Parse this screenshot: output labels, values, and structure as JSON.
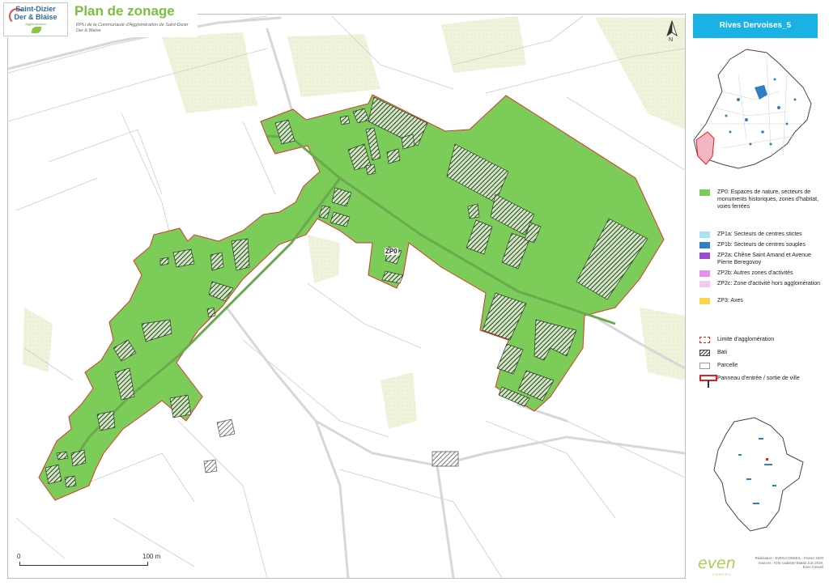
{
  "header": {
    "logo_line1": "Saint-Dizier",
    "logo_line2": "Der & Blaise",
    "logo_line3": "Agglomération",
    "title": "Plan de zonage",
    "subtitle": "RPLi de la Communauté d'Agglomération de Saint-Dizier Der & Blaise"
  },
  "panel": {
    "header": "Rives Dervoises_5"
  },
  "map": {
    "zone_label": "ZP0",
    "north_label": "N",
    "scale_start": "0",
    "scale_end": "100 m",
    "zone_fill_color": "#7ccc5a",
    "zone_outline_color": "#e0342a"
  },
  "legend": [
    {
      "label": "ZP0: Espaces de nature, secteurs de monuments historiques, zones d'habitat, voies ferrées",
      "color": "#7ccc5a",
      "kind": "fill"
    },
    {
      "label": "ZP1a: Secteurs de centres stictes",
      "color": "#a9e3f2",
      "kind": "fill"
    },
    {
      "label": "ZP1b: Secteurs de centres souples",
      "color": "#2f7fc4",
      "kind": "fill"
    },
    {
      "label": "ZP2a: Chêne Saint Amand et Avenue Pierre Beregovoy",
      "color": "#9a4fc9",
      "kind": "fill"
    },
    {
      "label": "ZP2b: Autres zones d'activités",
      "color": "#e98ff0",
      "kind": "fill"
    },
    {
      "label": "ZP2c: Zone d'activité hors agglomération",
      "color": "#f6c7ef",
      "kind": "fill"
    },
    {
      "label": "ZP3: Axes",
      "color": "#f5d84a",
      "kind": "fill"
    },
    {
      "label": "Limite d'agglomération",
      "color": "#e02020",
      "kind": "dashed"
    },
    {
      "label": "Bati",
      "color": "#444444",
      "kind": "hatch"
    },
    {
      "label": "Parcelle",
      "color": "#999999",
      "kind": "plain"
    },
    {
      "label": "Panneau d'entrée / sortie de ville",
      "color": "#e02020",
      "kind": "panneau"
    }
  ],
  "credits": {
    "line1": "Réalisation : EVEN CONSEIL - Février 2020",
    "line2": "Sources : IGN, cadastre Etalab Juin 2019,",
    "line3": "Even Conseil"
  },
  "even_logo": {
    "name": "even",
    "sub": "CONSEIL"
  }
}
